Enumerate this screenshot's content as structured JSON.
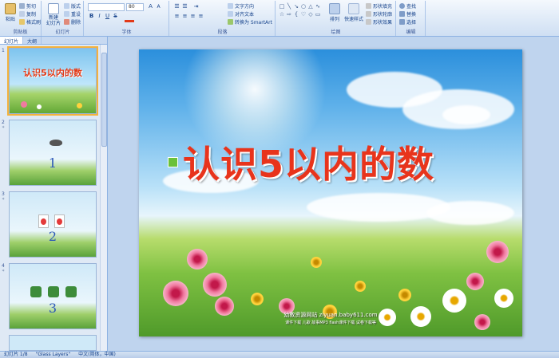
{
  "ribbon": {
    "clipboard": {
      "label": "剪贴板",
      "paste": "粘贴",
      "cut": "剪切",
      "copy": "复制",
      "format_painter": "格式刷"
    },
    "slides": {
      "label": "幻灯片",
      "new_slide": "新建\n幻灯片",
      "layout": "版式",
      "reset": "重设",
      "delete": "删除"
    },
    "font": {
      "label": "字体",
      "font_size": "80",
      "bold": "B",
      "italic": "I",
      "underline": "U",
      "strike": "S"
    },
    "paragraph": {
      "label": "段落",
      "text_direction": "文字方向",
      "align_text": "对齐文本",
      "smartart": "转换为 SmartArt"
    },
    "drawing": {
      "label": "绘图",
      "arrange": "排列",
      "quick_styles": "快速样式",
      "shape_fill": "形状填充",
      "shape_outline": "形状轮廓",
      "shape_effects": "形状效果"
    },
    "editing": {
      "label": "编辑",
      "find": "查找",
      "replace": "替换",
      "select": "选择"
    }
  },
  "panel": {
    "tabs": [
      "幻灯片",
      "大纲"
    ],
    "thumbnails": [
      {
        "num": "1",
        "title": "认识5以内的数",
        "digit": ""
      },
      {
        "num": "2",
        "title": "",
        "digit": "1"
      },
      {
        "num": "3",
        "title": "",
        "digit": "2"
      },
      {
        "num": "4",
        "title": "",
        "digit": "3"
      }
    ]
  },
  "slide": {
    "title": "认识5以内的数",
    "watermark": "幼教资源网站  ziyuan.baby611.com",
    "watermark_sub": "课件下载 儿歌 故事MP3 flash课件下载 试卷下载等"
  },
  "status": {
    "slide_info": "幻灯片 1/8",
    "theme": "\"Glass Layers\"",
    "language": "中文(简体，中国)"
  },
  "colors": {
    "title": "#e8341c",
    "accent": "#15428b",
    "bullet": "#6ac13a"
  }
}
